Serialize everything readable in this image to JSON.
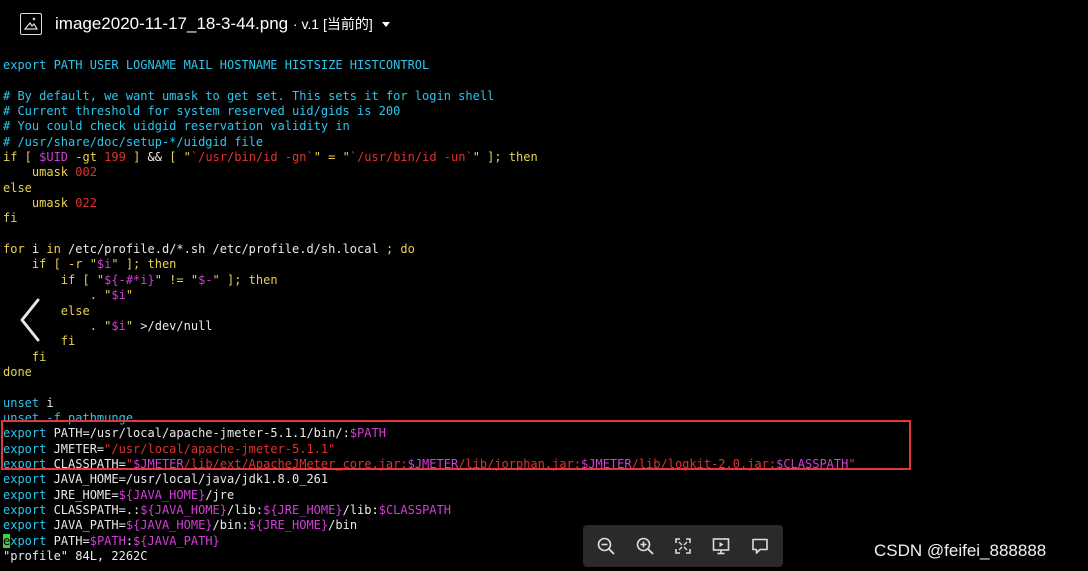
{
  "viewer": {
    "filename": "image2020-11-17_18-3-44.png",
    "version_label": "v.1 [当前的]",
    "watermark": "CSDN @feifei_888888",
    "icons": {
      "image": "image-icon",
      "prev": "chevron-left-icon",
      "zoom_out": "zoom-out-icon",
      "zoom_in": "zoom-in-icon",
      "fit": "fit-screen-icon",
      "slideshow": "slideshow-icon",
      "comment": "comment-icon"
    }
  },
  "terminal": {
    "lines": [
      [
        [
          "c-cyan",
          "export PATH USER LOGNAME MAIL HOSTNAME HISTSIZE HISTCONTROL"
        ]
      ],
      [],
      [
        [
          "c-comment",
          "# By default, we want umask to get set. This sets it for login shell"
        ]
      ],
      [
        [
          "c-comment",
          "# Current threshold for system reserved uid/gids is 200"
        ]
      ],
      [
        [
          "c-comment",
          "# You could check uidgid reservation validity in"
        ]
      ],
      [
        [
          "c-comment",
          "# /usr/share/doc/setup-*/uidgid file"
        ]
      ],
      [
        [
          "c-yellow",
          "if [ "
        ],
        [
          "c-mag",
          "$UID"
        ],
        [
          "c-yellow",
          " -gt "
        ],
        [
          "c-red",
          "199"
        ],
        [
          "c-yellow",
          " ] "
        ],
        [
          "c-white",
          "&& "
        ],
        [
          "c-yellow",
          "[ \""
        ],
        [
          "c-red",
          "`/usr/bin/id -gn`"
        ],
        [
          "c-yellow",
          "\" = \""
        ],
        [
          "c-red",
          "`/usr/bin/id -un`"
        ],
        [
          "c-yellow",
          "\" ]; then"
        ]
      ],
      [
        [
          "c-yellow",
          "    umask "
        ],
        [
          "c-red",
          "002"
        ]
      ],
      [
        [
          "c-yellow",
          "else"
        ]
      ],
      [
        [
          "c-yellow",
          "    umask "
        ],
        [
          "c-red",
          "022"
        ]
      ],
      [
        [
          "c-yellow",
          "fi"
        ]
      ],
      [],
      [
        [
          "c-yellow",
          "for "
        ],
        [
          "c-white",
          "i "
        ],
        [
          "c-yellow",
          "in "
        ],
        [
          "c-white",
          "/etc/profile.d/*.sh /etc/profile.d/sh.local "
        ],
        [
          "c-yellow",
          "; do"
        ]
      ],
      [
        [
          "c-yellow",
          "    if [ -r \""
        ],
        [
          "c-mag",
          "$i"
        ],
        [
          "c-yellow",
          "\" ]; then"
        ]
      ],
      [
        [
          "c-yellow",
          "        if [ \""
        ],
        [
          "c-mag",
          "${-#*i}"
        ],
        [
          "c-yellow",
          "\" != \""
        ],
        [
          "c-mag",
          "$-"
        ],
        [
          "c-yellow",
          "\" ]; then"
        ]
      ],
      [
        [
          "c-yellow",
          "            . \""
        ],
        [
          "c-mag",
          "$i"
        ],
        [
          "c-yellow",
          "\""
        ]
      ],
      [
        [
          "c-yellow",
          "        else"
        ]
      ],
      [
        [
          "c-yellow",
          "            . \""
        ],
        [
          "c-mag",
          "$i"
        ],
        [
          "c-yellow",
          "\" "
        ],
        [
          "c-white",
          ">/dev/null"
        ]
      ],
      [
        [
          "c-yellow",
          "        fi"
        ]
      ],
      [
        [
          "c-yellow",
          "    fi"
        ]
      ],
      [
        [
          "c-yellow",
          "done"
        ]
      ],
      [],
      [
        [
          "c-cyan",
          "unset "
        ],
        [
          "c-white",
          "i"
        ]
      ],
      [
        [
          "c-cyan",
          "unset -f pathmunge"
        ]
      ],
      [
        [
          "c-cyan",
          "export "
        ],
        [
          "c-white",
          "PATH=/usr/local/apache-jmeter-5.1.1/bin/:"
        ],
        [
          "c-mag",
          "$PATH"
        ]
      ],
      [
        [
          "c-cyan",
          "export "
        ],
        [
          "c-white",
          "JMETER="
        ],
        [
          "c-red",
          "\"/usr/local/apache-jmeter-5.1.1\""
        ]
      ],
      [
        [
          "c-cyan",
          "export "
        ],
        [
          "c-white",
          "CLASSPATH="
        ],
        [
          "c-red",
          "\""
        ],
        [
          "c-mag",
          "$JMETER"
        ],
        [
          "c-red",
          "/lib/ext/ApacheJMeter_core.jar:"
        ],
        [
          "c-mag",
          "$JMETER"
        ],
        [
          "c-red",
          "/lib/jorphan.jar:"
        ],
        [
          "c-mag",
          "$JMETER"
        ],
        [
          "c-red",
          "/lib/logkit-2.0.jar:"
        ],
        [
          "c-mag",
          "$CLASSPATH"
        ],
        [
          "c-red",
          "\""
        ]
      ],
      [
        [
          "c-cyan",
          "export "
        ],
        [
          "c-white",
          "JAVA_HOME=/usr/local/java/jdk1.8.0_261"
        ]
      ],
      [
        [
          "c-cyan",
          "export "
        ],
        [
          "c-white",
          "JRE_HOME="
        ],
        [
          "c-mag",
          "${JAVA_HOME}"
        ],
        [
          "c-white",
          "/jre"
        ]
      ],
      [
        [
          "c-cyan",
          "export "
        ],
        [
          "c-white",
          "CLASSPATH=.:"
        ],
        [
          "c-mag",
          "${JAVA_HOME}"
        ],
        [
          "c-white",
          "/lib:"
        ],
        [
          "c-mag",
          "${JRE_HOME}"
        ],
        [
          "c-white",
          "/lib:"
        ],
        [
          "c-mag",
          "$CLASSPATH"
        ]
      ],
      [
        [
          "c-cyan",
          "export "
        ],
        [
          "c-white",
          "JAVA_PATH="
        ],
        [
          "c-mag",
          "${JAVA_HOME}"
        ],
        [
          "c-white",
          "/bin:"
        ],
        [
          "c-mag",
          "${JRE_HOME}"
        ],
        [
          "c-white",
          "/bin"
        ]
      ],
      [
        [
          "cursor",
          "e"
        ],
        [
          "c-cyan",
          "xport "
        ],
        [
          "c-white",
          "PATH="
        ],
        [
          "c-mag",
          "$PATH"
        ],
        [
          "c-white",
          ":"
        ],
        [
          "c-mag",
          "${JAVA_PATH}"
        ]
      ],
      [
        [
          "c-white",
          "\"profile\" 84L, 2262C"
        ]
      ]
    ]
  }
}
